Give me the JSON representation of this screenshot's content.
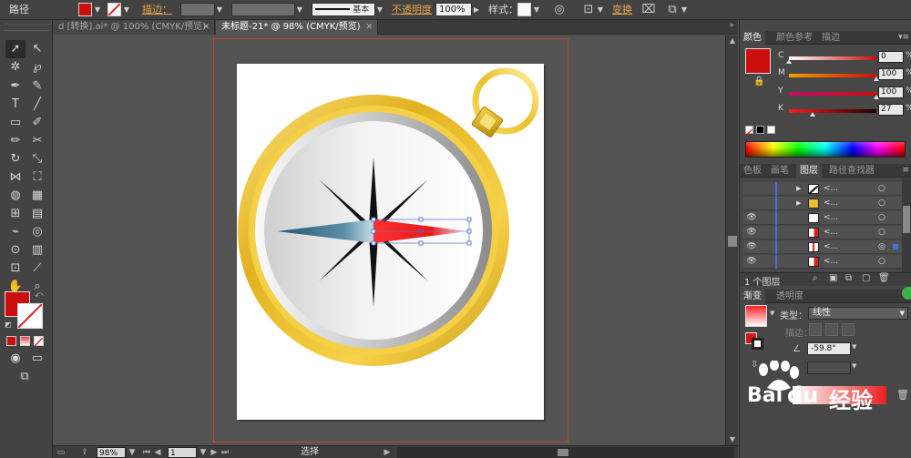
{
  "control_bar": {
    "object_type": "路径",
    "stroke_label": "描边：",
    "basic_label": "基本",
    "opacity_label": "不透明度",
    "opacity_value": "100%",
    "style_label": "样式：",
    "transform_label": "变换",
    "fill_color": "#cc0d0d"
  },
  "tabs": [
    {
      "label": "d [转换].ai* @ 100% (CMYK/预览)"
    },
    {
      "label": "未标题-21* @ 98% (CMYK/预览)"
    }
  ],
  "status_bar": {
    "zoom": "98%",
    "artboard_num": "1",
    "tool_name": "选择"
  },
  "color_panel": {
    "tabs": [
      "颜色",
      "颜色参考",
      "描边"
    ],
    "fill_color": "#cc0d0d",
    "channels": [
      {
        "label": "C",
        "value": "0",
        "percent": 0
      },
      {
        "label": "M",
        "value": "100",
        "percent": 100
      },
      {
        "label": "Y",
        "value": "100",
        "percent": 100
      },
      {
        "label": "K",
        "value": "27",
        "percent": 27
      }
    ],
    "pct_sign": "%"
  },
  "layers_panel": {
    "tabs": [
      "色板",
      "画笔",
      "图层",
      "路径查找器"
    ],
    "rows": [
      {
        "name": "<...",
        "has_eye": false,
        "twirl": "▶"
      },
      {
        "name": "<...",
        "has_eye": false,
        "twirl": "▶"
      },
      {
        "name": "<...",
        "has_eye": true,
        "twirl": ""
      },
      {
        "name": "<...",
        "has_eye": true,
        "twirl": ""
      },
      {
        "name": "<...",
        "has_eye": true,
        "twirl": ""
      },
      {
        "name": "<...",
        "has_eye": true,
        "twirl": ""
      }
    ],
    "layer_count": "1 个图层"
  },
  "gradient_panel": {
    "tabs": [
      "渐变",
      "透明度"
    ],
    "type_label": "类型：",
    "type_value": "线性",
    "stroke_label": "描边：",
    "angle": "-59.8°"
  },
  "watermark": {
    "brand": "Bai",
    "sub": "du",
    "text": "经验"
  }
}
